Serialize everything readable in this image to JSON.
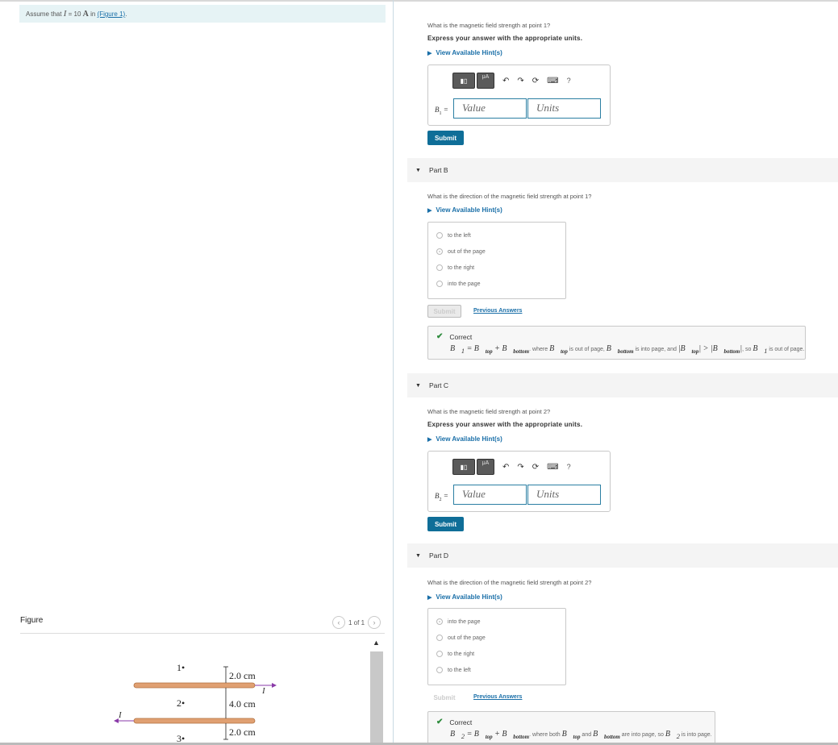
{
  "assume": {
    "prefix": "Assume that",
    "var": "I",
    "eq": " = 10 ",
    "unit": "A",
    "mid": " in ",
    "link": "(Figure 1)",
    "end": "."
  },
  "figure": {
    "label": "Figure",
    "pager_text": "1 of 1",
    "prev_icon": "‹",
    "next_icon": "›",
    "points": [
      "1•",
      "2•",
      "3•"
    ],
    "dims": [
      "2.0 cm",
      "4.0 cm",
      "2.0 cm"
    ],
    "current_label": "I"
  },
  "partA": {
    "question": "What is the magnetic field strength at point 1?",
    "instruction": "Express your answer with the appropriate units.",
    "hint": "View Available Hint(s)",
    "var": "B",
    "var_sub": "1",
    "value_placeholder": "Value",
    "units_placeholder": "Units",
    "submit": "Submit"
  },
  "partB": {
    "title": "Part B",
    "question": "What is the direction of the magnetic field strength at point 1?",
    "hint": "View Available Hint(s)",
    "choices": [
      "to the left",
      "out of the page",
      "to the right",
      "into the page"
    ],
    "submit": "Submit",
    "prev_answers": "Previous Answers",
    "feedback_title": "Correct",
    "feedback_text_1": "where",
    "feedback_text_2": "is out of page,",
    "feedback_text_3": "is into page, and",
    "feedback_text_4": ", so",
    "feedback_text_5": "is out of page."
  },
  "partC": {
    "title": "Part C",
    "question": "What is the magnetic field strength at point 2?",
    "instruction": "Express your answer with the appropriate units.",
    "hint": "View Available Hint(s)",
    "var": "B",
    "var_sub": "2",
    "value_placeholder": "Value",
    "units_placeholder": "Units",
    "submit": "Submit"
  },
  "partD": {
    "title": "Part D",
    "question": "What is the direction of the magnetic field strength at point 2?",
    "hint": "View Available Hint(s)",
    "choices": [
      "into the page",
      "out of the page",
      "to the right",
      "to the left"
    ],
    "submit": "Submit",
    "prev_answers": "Previous Answers",
    "feedback_title": "Correct",
    "feedback_text_1": "where both",
    "feedback_text_2": "and",
    "feedback_text_3": "are into page, so",
    "feedback_text_4": "is into page."
  },
  "toolbar": {
    "mu_label": "μA",
    "undo_icon": "↶",
    "redo_icon": "↷",
    "reset_icon": "⟳",
    "keyboard_icon": "⌨",
    "help_icon": "?"
  },
  "colors": {
    "accent": "#0f6e98",
    "link": "#1a6fa8",
    "wire": "#e0a072",
    "correct": "#2e8b3d"
  }
}
